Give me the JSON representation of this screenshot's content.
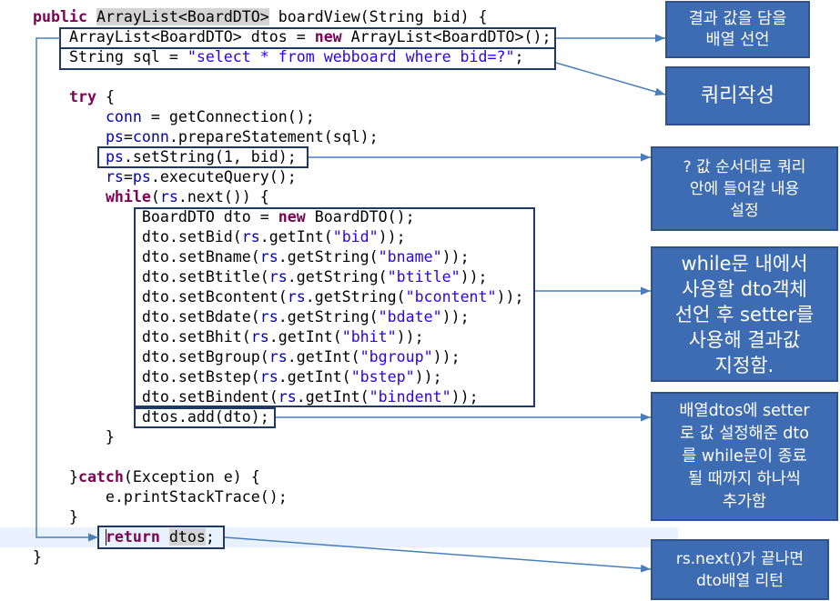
{
  "colors": {
    "keyword": "#7f0055",
    "string": "#2a00ff",
    "field": "#0000c0",
    "plain": "#000000",
    "occurrence_highlight": "#d4d4d4",
    "current_line_highlight": "#e8f2fe",
    "code_outline": "#1f3864",
    "callout_fill": "#3d6cb3",
    "callout_border": "#2f528f",
    "callout_text": "#ffffff",
    "arrow": "#4a7ebb"
  },
  "editor": {
    "lines": [
      [
        {
          "kw": "public"
        },
        {
          "t": " "
        },
        {
          "occ": "ArrayList<BoardDTO>"
        },
        {
          "t": " boardView(String bid) {"
        }
      ],
      [
        {
          "t": "    ArrayList<BoardDTO> dtos = "
        },
        {
          "kw": "new"
        },
        {
          "t": " ArrayList<BoardDTO>();"
        }
      ],
      [
        {
          "t": "    String sql = "
        },
        {
          "str": "\"select * from webboard where bid=?\""
        },
        {
          "t": ";"
        }
      ],
      [],
      [
        {
          "t": "    "
        },
        {
          "kw": "try"
        },
        {
          "t": " {"
        }
      ],
      [
        {
          "t": "        "
        },
        {
          "field": "conn"
        },
        {
          "t": " = getConnection();"
        }
      ],
      [
        {
          "t": "        "
        },
        {
          "field": "ps"
        },
        {
          "t": "="
        },
        {
          "field": "conn"
        },
        {
          "t": ".prepareStatement(sql);"
        }
      ],
      [
        {
          "t": "        "
        },
        {
          "field": "ps"
        },
        {
          "t": ".setString(1, bid);"
        }
      ],
      [
        {
          "t": "        "
        },
        {
          "field": "rs"
        },
        {
          "t": "="
        },
        {
          "field": "ps"
        },
        {
          "t": ".executeQuery();"
        }
      ],
      [
        {
          "t": "        "
        },
        {
          "kw": "while"
        },
        {
          "t": "("
        },
        {
          "field": "rs"
        },
        {
          "t": ".next()) {"
        }
      ],
      [
        {
          "t": "            BoardDTO dto = "
        },
        {
          "kw": "new"
        },
        {
          "t": " BoardDTO();"
        }
      ],
      [
        {
          "t": "            dto.setBid("
        },
        {
          "field": "rs"
        },
        {
          "t": ".getInt("
        },
        {
          "str": "\"bid\""
        },
        {
          "t": "));"
        }
      ],
      [
        {
          "t": "            dto.setBname("
        },
        {
          "field": "rs"
        },
        {
          "t": ".getString("
        },
        {
          "str": "\"bname\""
        },
        {
          "t": "));"
        }
      ],
      [
        {
          "t": "            dto.setBtitle("
        },
        {
          "field": "rs"
        },
        {
          "t": ".getString("
        },
        {
          "str": "\"btitle\""
        },
        {
          "t": "));"
        }
      ],
      [
        {
          "t": "            dto.setBcontent("
        },
        {
          "field": "rs"
        },
        {
          "t": ".getString("
        },
        {
          "str": "\"bcontent\""
        },
        {
          "t": "));"
        }
      ],
      [
        {
          "t": "            dto.setBdate("
        },
        {
          "field": "rs"
        },
        {
          "t": ".getString("
        },
        {
          "str": "\"bdate\""
        },
        {
          "t": "));"
        }
      ],
      [
        {
          "t": "            dto.setBhit("
        },
        {
          "field": "rs"
        },
        {
          "t": ".getInt("
        },
        {
          "str": "\"bhit\""
        },
        {
          "t": "));"
        }
      ],
      [
        {
          "t": "            dto.setBgroup("
        },
        {
          "field": "rs"
        },
        {
          "t": ".getInt("
        },
        {
          "str": "\"bgroup\""
        },
        {
          "t": "));"
        }
      ],
      [
        {
          "t": "            dto.setBstep("
        },
        {
          "field": "rs"
        },
        {
          "t": ".getInt("
        },
        {
          "str": "\"bstep\""
        },
        {
          "t": "));"
        }
      ],
      [
        {
          "t": "            dto.setBindent("
        },
        {
          "field": "rs"
        },
        {
          "t": ".getInt("
        },
        {
          "str": "\"bindent\""
        },
        {
          "t": "));"
        }
      ],
      [
        {
          "t": "            dtos.add(dto);"
        }
      ],
      [
        {
          "t": "        }"
        }
      ],
      [],
      [
        {
          "t": "    }"
        },
        {
          "kw": "catch"
        },
        {
          "t": "(Exception e) {"
        }
      ],
      [
        {
          "t": "        e.printStackTrace();"
        }
      ],
      [
        {
          "t": "    }"
        }
      ],
      [
        {
          "t": "        "
        },
        {
          "kw": "return"
        },
        {
          "t": " "
        },
        {
          "occ": "dtos"
        },
        {
          "t": ";"
        }
      ],
      [
        {
          "t": "}"
        }
      ]
    ]
  },
  "callouts": [
    {
      "lines": [
        "결과 값을 담을",
        "배열 선언"
      ]
    },
    {
      "lines": [
        "쿼리작성"
      ]
    },
    {
      "lines": [
        "? 값 순서대로 쿼리",
        "안에 들어갈 내용",
        "설정"
      ]
    },
    {
      "lines": [
        "while문 내에서",
        "사용할 dto객체",
        "선언 후 setter를",
        "사용해 결과값",
        "지정함."
      ]
    },
    {
      "lines": [
        "배열dtos에 setter",
        "로 값 설정해준 dto",
        "를 while문이 종료",
        "될 때까지 하나씩",
        "추가함"
      ]
    },
    {
      "lines": [
        "rs.next()가 끝나면",
        "dto배열 리턴"
      ]
    }
  ]
}
